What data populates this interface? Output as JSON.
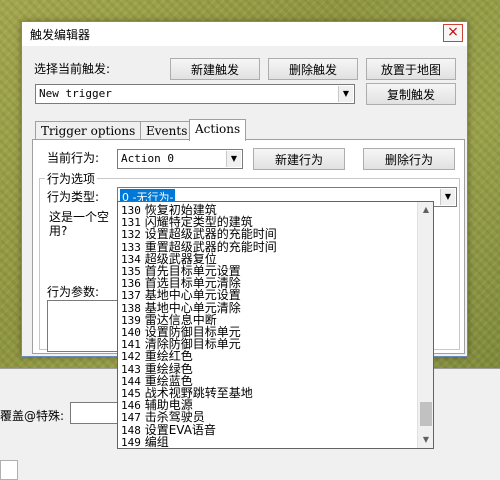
{
  "dialog": {
    "title": "触发编辑器",
    "close_glyph": "×",
    "select_trigger_label": "选择当前触发:",
    "new_trigger_button": "新建触发",
    "delete_trigger_button": "删除触发",
    "place_on_map_button": "放置于地图",
    "copy_trigger_button": "复制触发",
    "trigger_combo_value": "New trigger",
    "tabs": [
      "Trigger options",
      "Events",
      "Actions"
    ],
    "active_tab": "Actions",
    "current_action_label": "当前行为:",
    "action_combo_value": "Action 0",
    "new_action_button": "新建行为",
    "delete_action_button": "删除行为",
    "action_options_label": "行为选项",
    "action_type_label": "行为类型:",
    "action_type_value": "0 -无行为-",
    "description_text_line1": "这是一个空",
    "description_text_line2": "用?",
    "action_params_label": "行为参数:"
  },
  "dropdown": {
    "items": [
      {
        "num": "130",
        "text": "恢复初始建筑"
      },
      {
        "num": "131",
        "text": "闪耀特定类型的建筑"
      },
      {
        "num": "132",
        "text": "设置超级武器的充能时间"
      },
      {
        "num": "133",
        "text": "重置超级武器的充能时间"
      },
      {
        "num": "134",
        "text": "超级武器复位"
      },
      {
        "num": "135",
        "text": "首先目标单元设置"
      },
      {
        "num": "136",
        "text": "首选目标单元清除"
      },
      {
        "num": "137",
        "text": "基地中心单元设置"
      },
      {
        "num": "138",
        "text": "基地中心单元清除"
      },
      {
        "num": "139",
        "text": "雷达信息中断"
      },
      {
        "num": "140",
        "text": "设置防御目标单元"
      },
      {
        "num": "141",
        "text": "清除防御目标单元"
      },
      {
        "num": "142",
        "text": "重绘红色"
      },
      {
        "num": "143",
        "text": "重绘绿色"
      },
      {
        "num": "144",
        "text": "重绘蓝色"
      },
      {
        "num": "145",
        "text": "战术视野跳转至基地"
      },
      {
        "num": "146",
        "text": "辅助电源"
      },
      {
        "num": "147",
        "text": "击杀驾驶员"
      },
      {
        "num": "148",
        "text": "设置EVA语音"
      },
      {
        "num": "149",
        "text": "编组"
      }
    ]
  },
  "bottom_panel": {
    "overlay_label": "覆盖@特殊:"
  },
  "colors": {
    "selection_bg": "#0078d7",
    "dialog_border": "#6a8ab8"
  }
}
